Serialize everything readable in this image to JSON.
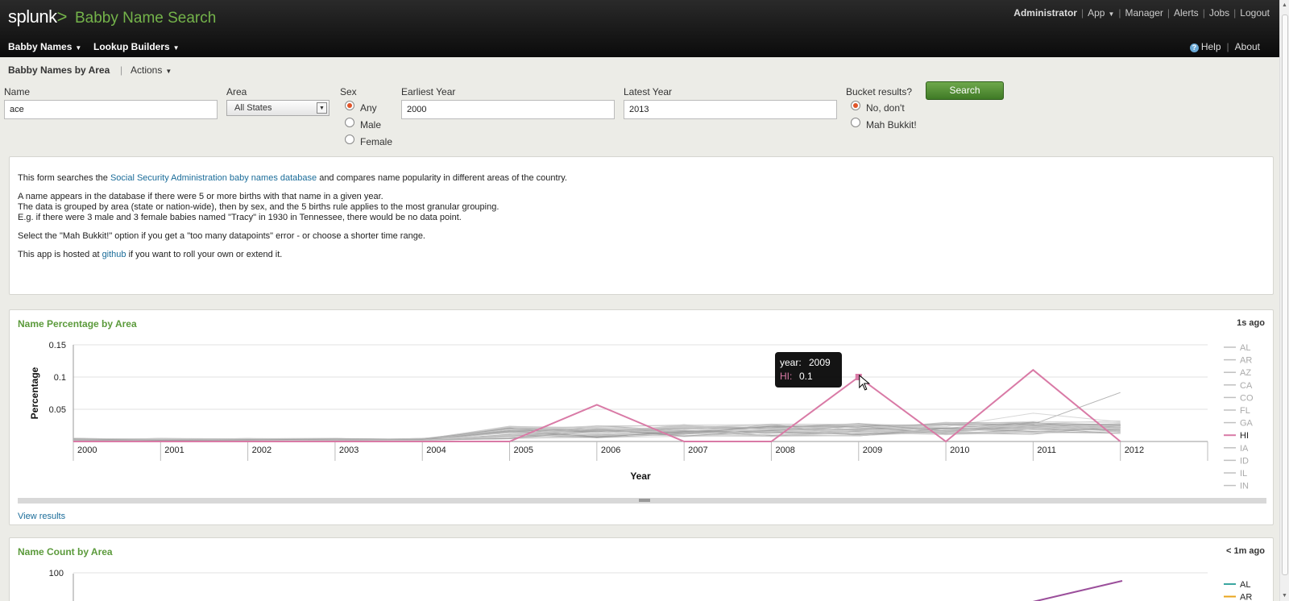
{
  "header": {
    "logo_text": "splunk",
    "logo_mark": ">",
    "app_title": "Babby Name Search",
    "user": "Administrator",
    "nav": [
      "App",
      "Manager",
      "Alerts",
      "Jobs",
      "Logout"
    ],
    "menus": [
      "Babby Names",
      "Lookup Builders"
    ],
    "help": "Help",
    "about": "About"
  },
  "view": {
    "title": "Babby Names by Area",
    "actions": "Actions"
  },
  "form": {
    "name_label": "Name",
    "name_value": "ace",
    "area_label": "Area",
    "area_value": "All States",
    "sex_label": "Sex",
    "sex_options": [
      "Any",
      "Male",
      "Female"
    ],
    "sex_selected": "Any",
    "earliest_label": "Earliest Year",
    "earliest_value": "2000",
    "latest_label": "Latest Year",
    "latest_value": "2013",
    "bucket_label": "Bucket results?",
    "bucket_options": [
      "No, don't",
      "Mah Bukkit!"
    ],
    "bucket_selected": "No, don't",
    "search_label": "Search"
  },
  "info": {
    "p1_pre": "This form searches the ",
    "p1_link": "Social Security Administration baby names database",
    "p1_post": " and compares name popularity in different areas of the country.",
    "p2_l1": "A name appears in the database if there were 5 or more births with that name in a given year.",
    "p2_l2": "The data is grouped by area (state or nation-wide), then by sex, and the 5 births rule applies to the most granular grouping.",
    "p2_l3": "E.g. if there were 3 male and 3 female babies named \"Tracy\" in 1930 in Tennessee, there would be no data point.",
    "p3": "Select the \"Mah Bukkit!\" option if you get a \"too many datapoints\" error - or choose a shorter time range.",
    "p4_pre": "This app is hosted at ",
    "p4_link": "github",
    "p4_post": " if you want to roll your own or extend it."
  },
  "panel1": {
    "title": "Name Percentage by Area",
    "timestamp": "1s ago",
    "view_results": "View results",
    "tooltip": {
      "year_label": "year:",
      "year_value": "2009",
      "series_label": "HI:",
      "series_value": "0.1"
    }
  },
  "panel2": {
    "title": "Name Count by Area",
    "timestamp": "< 1m ago"
  },
  "colors": {
    "accent": "#5b9a3b",
    "highlight": "#d97aa6",
    "background_series": "#c8c8c8"
  },
  "chart_data": [
    {
      "type": "line",
      "title": "Name Percentage by Area",
      "xlabel": "Year",
      "ylabel": "Percentage",
      "x": [
        "2000",
        "2001",
        "2002",
        "2003",
        "2004",
        "2005",
        "2006",
        "2007",
        "2008",
        "2009",
        "2010",
        "2011",
        "2012"
      ],
      "ylim": [
        0,
        0.15
      ],
      "yticks": [
        "0.05",
        "0.1",
        "0.15"
      ],
      "legend_position": "right",
      "series": [
        {
          "name": "AL",
          "highlight": false
        },
        {
          "name": "AR",
          "highlight": false
        },
        {
          "name": "AZ",
          "highlight": false
        },
        {
          "name": "CA",
          "highlight": false
        },
        {
          "name": "CO",
          "highlight": false
        },
        {
          "name": "FL",
          "highlight": false
        },
        {
          "name": "GA",
          "highlight": false
        },
        {
          "name": "HI",
          "highlight": true,
          "values": [
            0,
            0,
            0,
            0,
            0,
            0,
            0.057,
            0,
            0,
            0.1,
            0,
            0.111,
            0
          ]
        },
        {
          "name": "IA",
          "highlight": false
        },
        {
          "name": "ID",
          "highlight": false
        },
        {
          "name": "IL",
          "highlight": false
        },
        {
          "name": "IN",
          "highlight": false
        }
      ]
    },
    {
      "type": "line",
      "title": "Name Count by Area",
      "yticks": [
        "100"
      ],
      "legend_position": "right",
      "series": [
        {
          "name": "AL",
          "color": "#3aa6a0"
        },
        {
          "name": "AR",
          "color": "#e8a41c"
        }
      ]
    }
  ]
}
